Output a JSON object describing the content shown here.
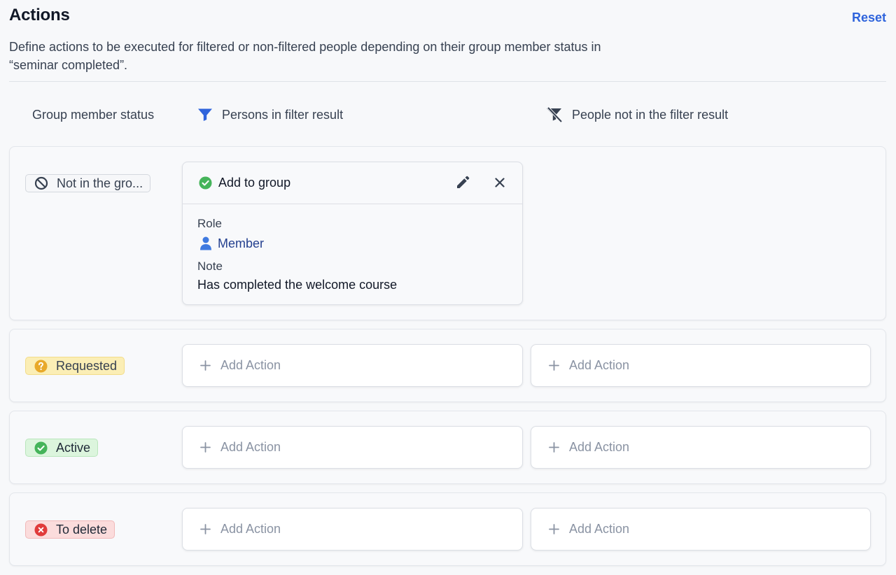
{
  "header": {
    "title": "Actions",
    "reset_label": "Reset",
    "description": "Define actions to be executed for filtered or non-filtered people depending on their group member status in “seminar completed”."
  },
  "columns": {
    "status": "Group member status",
    "filtered": "Persons in filter result",
    "non_filtered": "People not in the filter result"
  },
  "rows": [
    {
      "status": "Not in the gro...",
      "status_icon": "block-icon",
      "action": {
        "title": "Add to group",
        "role_label": "Role",
        "role_value": "Member",
        "note_label": "Note",
        "note_value": "Has completed the welcome course"
      }
    },
    {
      "status": "Requested",
      "status_icon": "question-icon",
      "status_color": "#e8a92a",
      "add_left": "Add Action",
      "add_right": "Add Action"
    },
    {
      "status": "Active",
      "status_icon": "check-circle-icon",
      "status_color": "#45b45a",
      "add_left": "Add Action",
      "add_right": "Add Action"
    },
    {
      "status": "To delete",
      "status_icon": "x-circle-icon",
      "status_color": "#e03b3b",
      "add_left": "Add Action",
      "add_right": "Add Action"
    }
  ],
  "colors": {
    "accent": "#2f64dc",
    "link": "#24408f",
    "success": "#45b45a"
  }
}
